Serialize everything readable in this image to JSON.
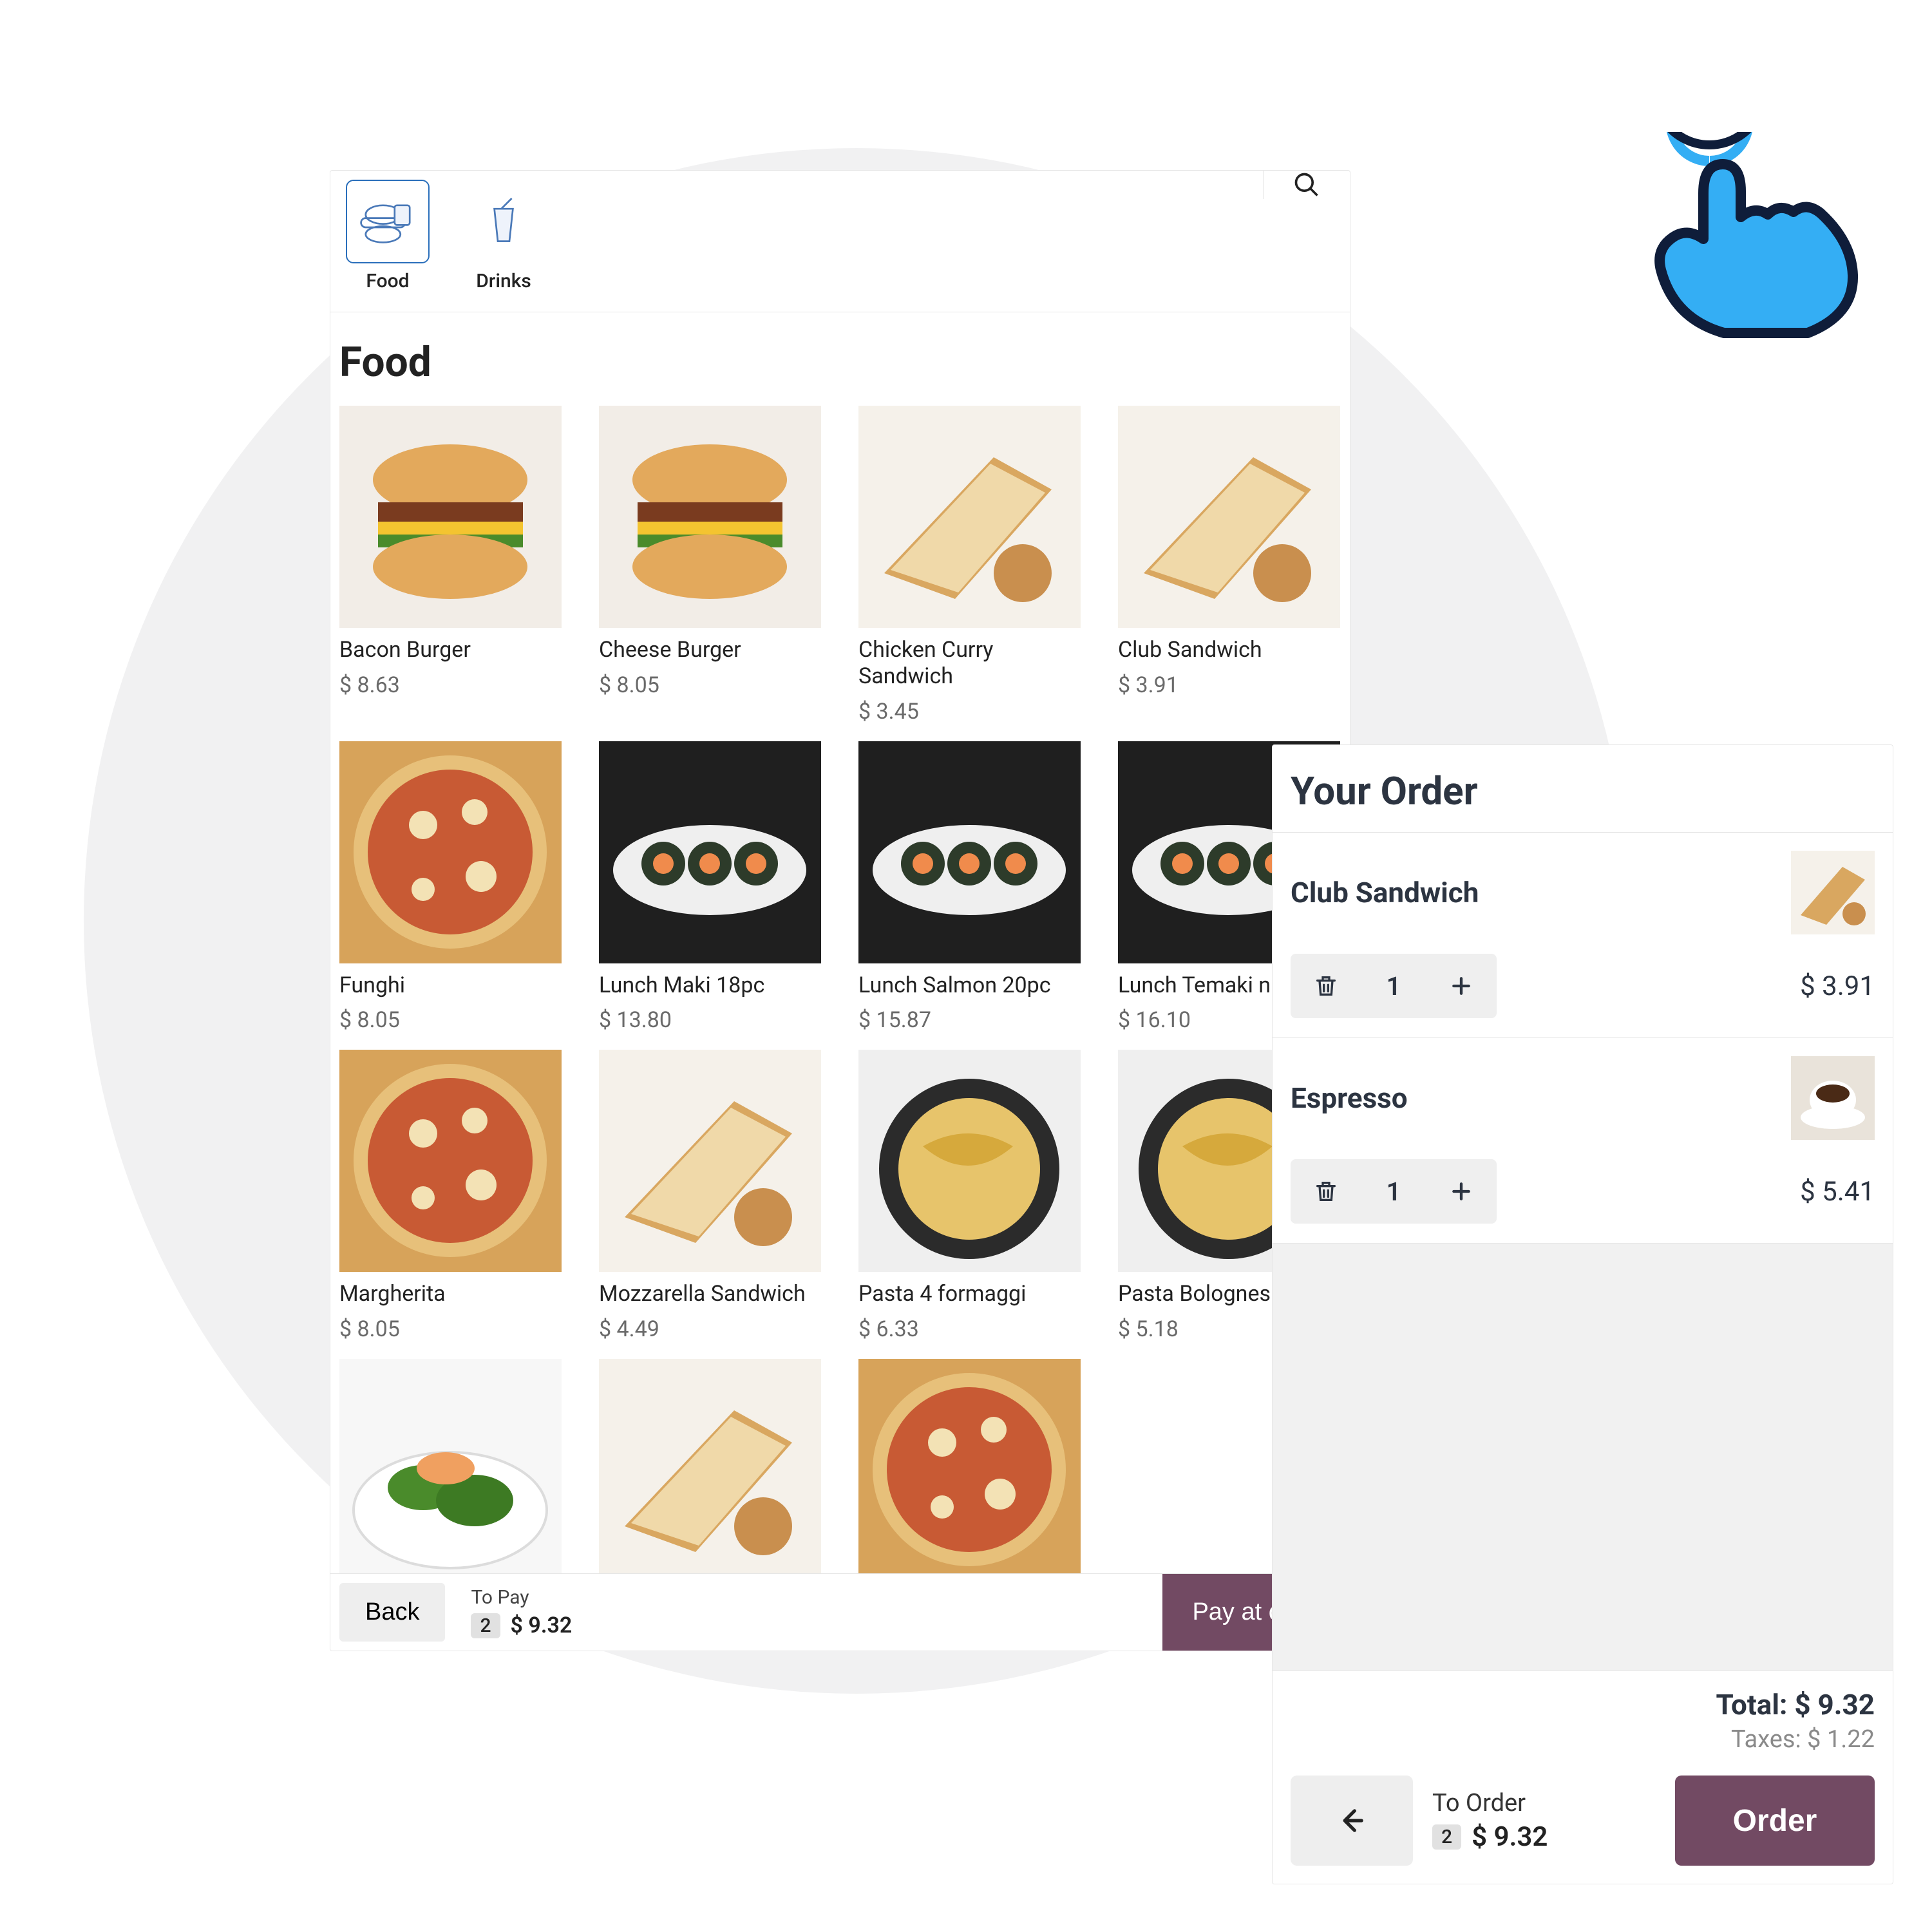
{
  "tabs": {
    "food": "Food",
    "drinks": "Drinks",
    "active": "food"
  },
  "section_title": "Food",
  "products": [
    {
      "name": "Bacon Burger",
      "price": "$ 8.63",
      "img": "burger"
    },
    {
      "name": "Cheese Burger",
      "price": "$ 8.05",
      "img": "burger"
    },
    {
      "name": "Chicken Curry Sandwich",
      "price": "$ 3.45",
      "img": "sandwich"
    },
    {
      "name": "Club Sandwich",
      "price": "$ 3.91",
      "img": "sandwich"
    },
    {
      "name": "Funghi",
      "price": "$ 8.05",
      "img": "pizza"
    },
    {
      "name": "Lunch Maki 18pc",
      "price": "$ 13.80",
      "img": "sushi"
    },
    {
      "name": "Lunch Salmon 20pc",
      "price": "$ 15.87",
      "img": "sushi"
    },
    {
      "name": "Lunch Temaki n",
      "price": "$ 16.10",
      "img": "sushi"
    },
    {
      "name": "Margherita",
      "price": "$ 8.05",
      "img": "pizza"
    },
    {
      "name": "Mozzarella Sandwich",
      "price": "$ 4.49",
      "img": "sandwich"
    },
    {
      "name": "Pasta 4 formaggi",
      "price": "$ 6.33",
      "img": "pasta"
    },
    {
      "name": "Pasta Bolognes",
      "price": "$ 5.18",
      "img": "pasta"
    },
    {
      "name": "",
      "price": "",
      "img": "salad"
    },
    {
      "name": "",
      "price": "",
      "img": "sandwich"
    },
    {
      "name": "",
      "price": "",
      "img": "pizza"
    }
  ],
  "pos_footer": {
    "back": "Back",
    "to_pay_label": "To Pay",
    "count": "2",
    "amount": "$ 9.32",
    "pay_btn": "Pay at cash"
  },
  "order": {
    "title": "Your Order",
    "items": [
      {
        "name": "Club Sandwich",
        "qty": "1",
        "price": "$ 3.91",
        "img": "sandwich"
      },
      {
        "name": "Espresso",
        "qty": "1",
        "price": "$ 5.41",
        "img": "coffee"
      }
    ],
    "total_label": "Total:",
    "total_value": "$ 9.32",
    "tax_label": "Taxes:",
    "tax_value": "$ 1.22",
    "to_order_label": "To Order",
    "to_order_count": "2",
    "to_order_amount": "$ 9.32",
    "order_btn": "Order"
  }
}
